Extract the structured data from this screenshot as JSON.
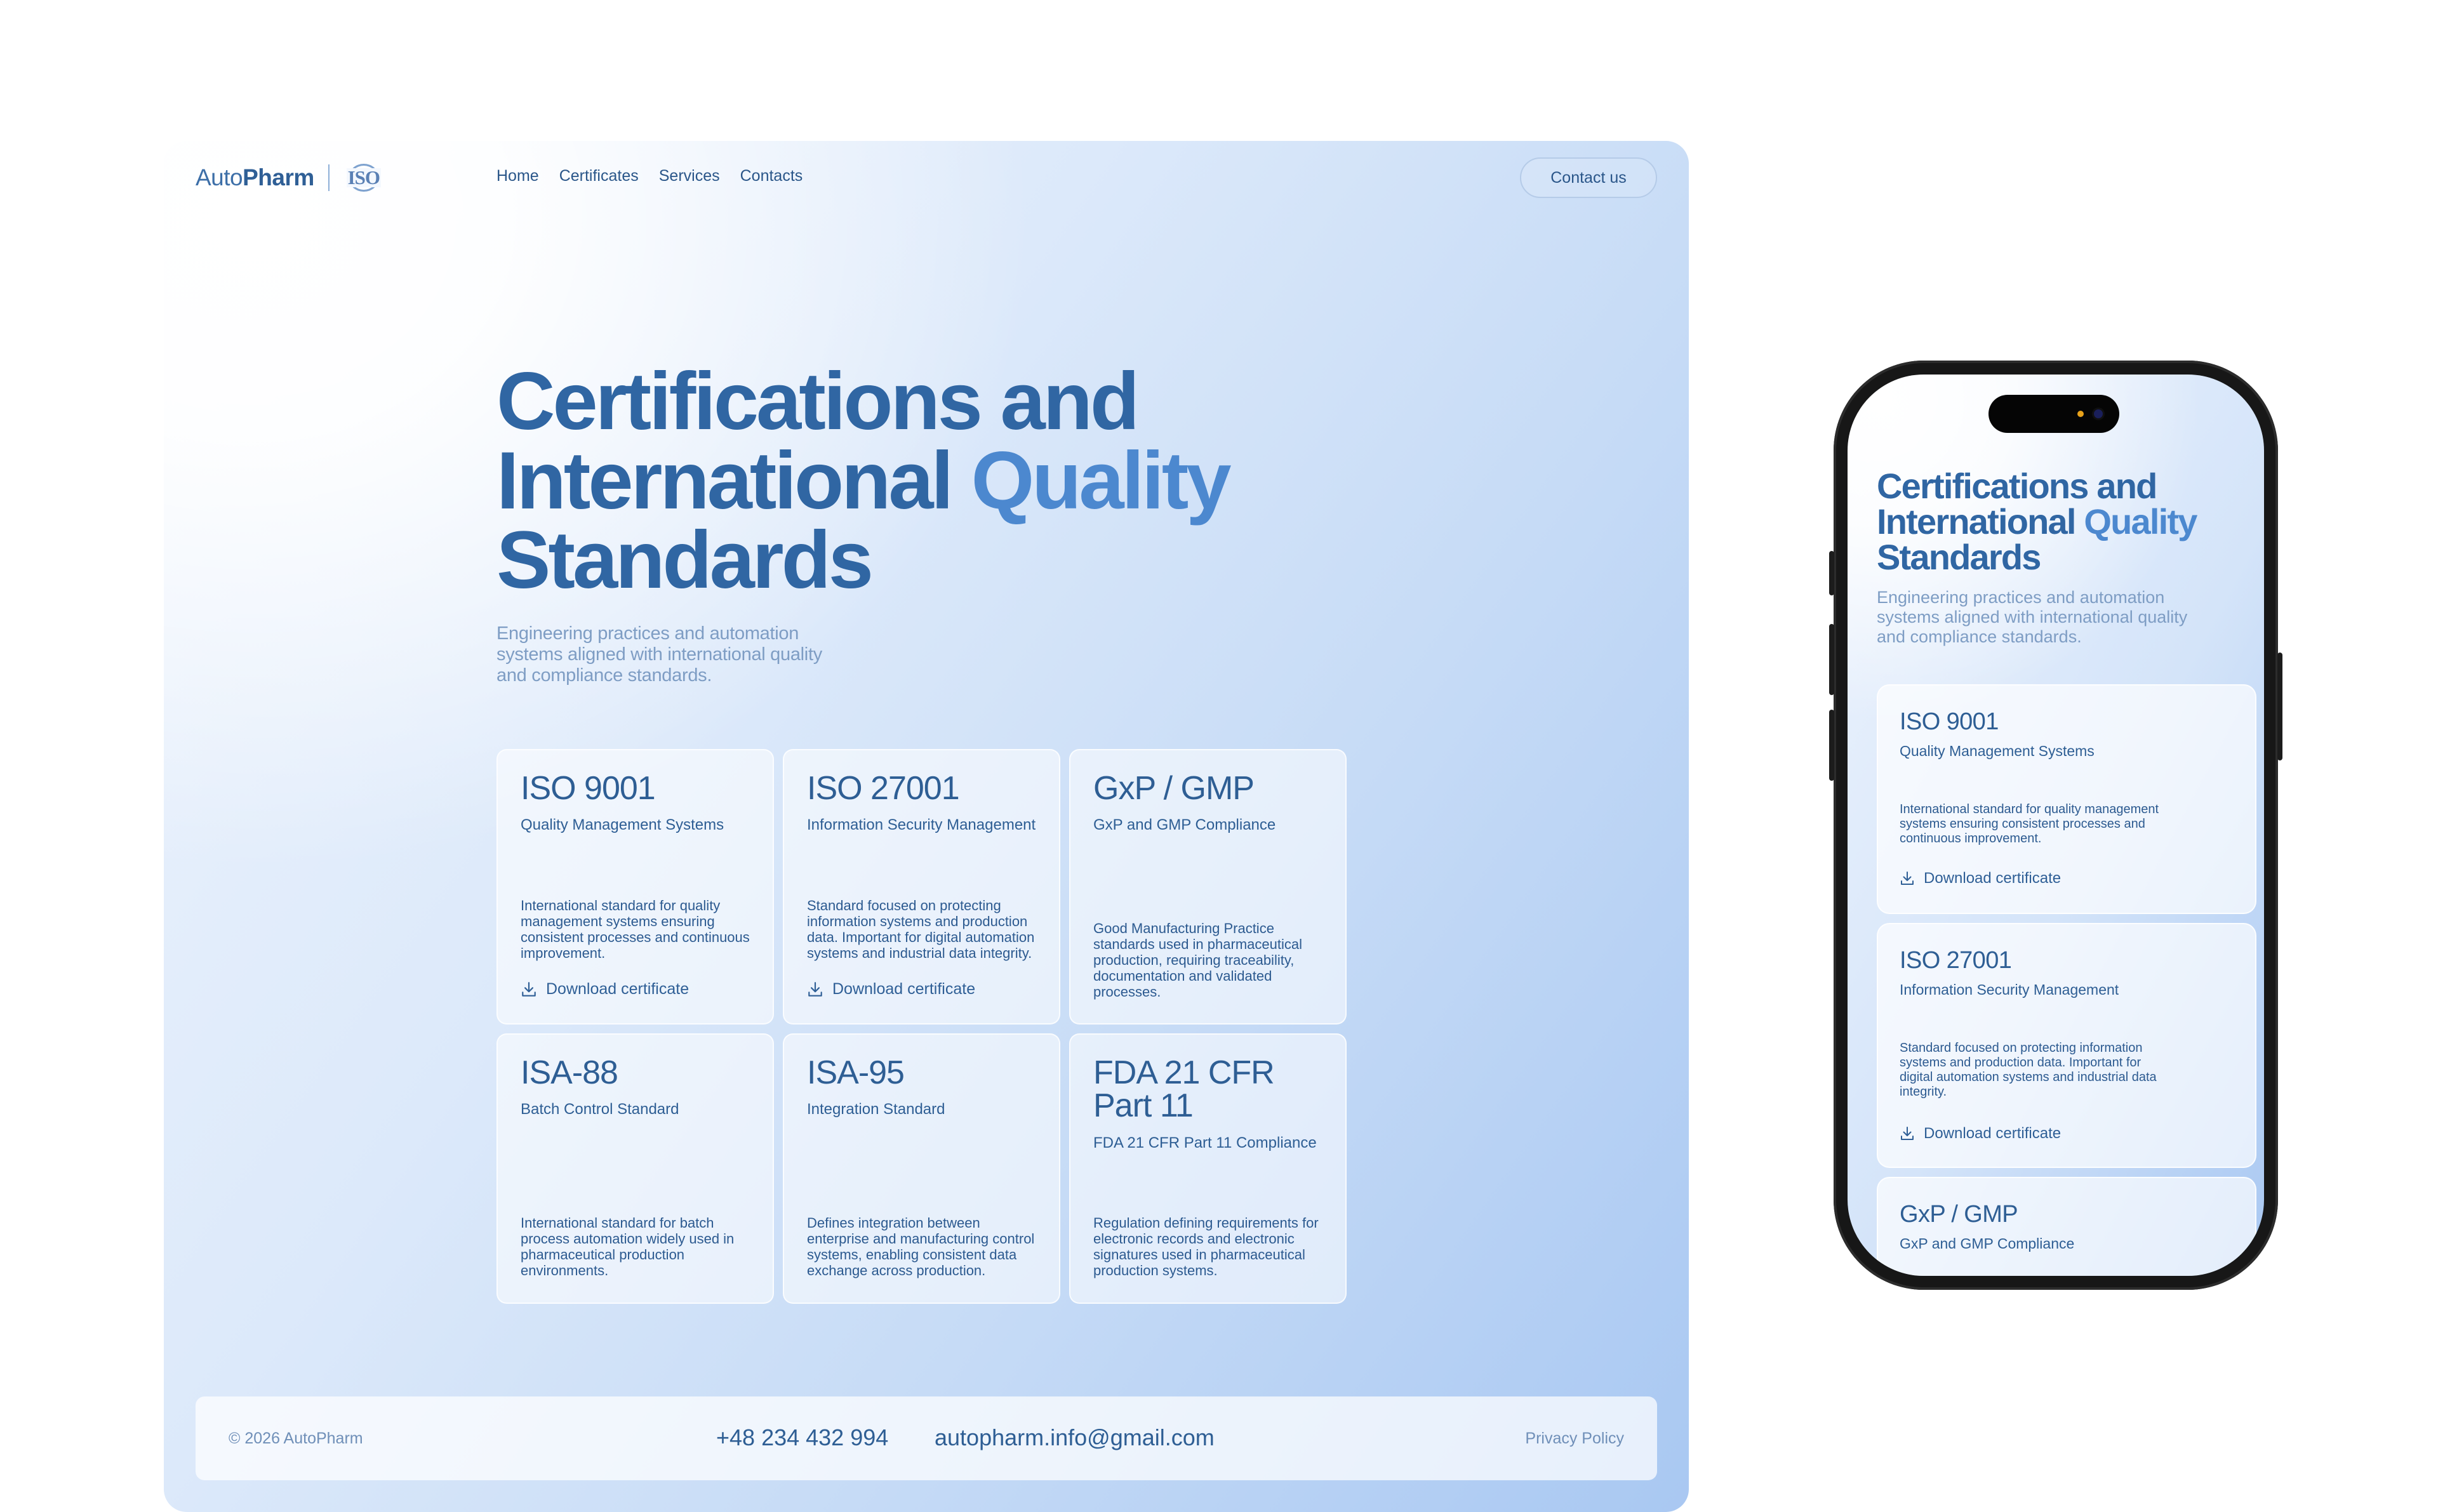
{
  "brand": {
    "name_prefix": "Auto",
    "name_suffix": "Pharm",
    "badge": "ISO"
  },
  "nav": {
    "links": [
      "Home",
      "Certificates",
      "Services",
      "Contacts"
    ],
    "cta": "Contact us"
  },
  "hero": {
    "title_line1": "Certifications and",
    "title_line2a": "International ",
    "title_line2b": "Quality",
    "title_line3": "Standards",
    "subtitle": "Engineering practices and automation systems aligned with international quality and compliance standards."
  },
  "cards": [
    {
      "title": "ISO 9001",
      "subtitle": "Quality Management Systems",
      "description": "International standard for quality management systems ensuring consistent processes and continuous improvement.",
      "download": "Download certificate"
    },
    {
      "title": "ISO 27001",
      "subtitle": "Information Security Management",
      "description": "Standard focused on protecting information systems and production data. Important for digital automation systems and industrial data integrity.",
      "download": "Download certificate"
    },
    {
      "title": "GxP / GMP",
      "subtitle": "GxP and GMP Compliance",
      "description": "Good Manufacturing Practice standards used in pharmaceutical production, requiring traceability, documentation and validated processes."
    },
    {
      "title": "ISA-88",
      "subtitle": "Batch Control Standard",
      "description": "International standard for batch process automation widely used in pharmaceutical production environments."
    },
    {
      "title": "ISA-95",
      "subtitle": "Integration Standard",
      "description": "Defines integration between enterprise and manufacturing control systems, enabling consistent data exchange across production."
    },
    {
      "title": "FDA 21 CFR Part 11",
      "subtitle": "FDA 21 CFR Part 11 Compliance",
      "description": "Regulation defining requirements for electronic records and electronic signatures used in pharmaceutical production systems."
    }
  ],
  "footer": {
    "copyright": "© 2026 AutoPharm",
    "phone": "+48 234 432 994",
    "email": "autopharm.info@gmail.com",
    "privacy": "Privacy Policy"
  },
  "icons": {
    "download": "download-icon",
    "badge": "iso-badge-icon"
  },
  "colors": {
    "primary": "#3066a3",
    "accent": "#4c88cf",
    "muted": "#7e9dc4",
    "gradient_start": "#eef4fd",
    "gradient_end": "#a9c8f2",
    "phone_frame": "#171717"
  }
}
